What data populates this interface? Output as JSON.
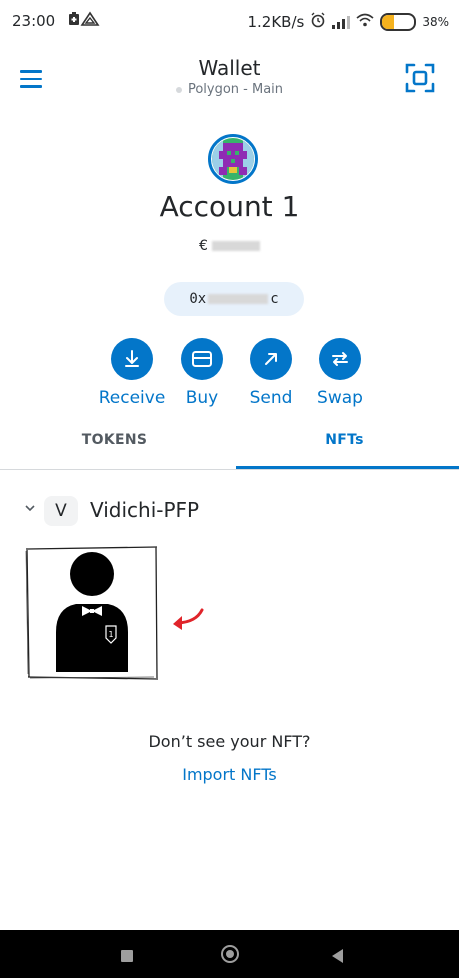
{
  "status_bar": {
    "time": "23:00",
    "net_speed": "1.2KB/s",
    "battery": "38%"
  },
  "header": {
    "title": "Wallet",
    "network": "Polygon - Main"
  },
  "account": {
    "name": "Account 1",
    "balance_prefix": "€",
    "address_prefix": "0x",
    "address_suffix": "c"
  },
  "actions": [
    {
      "label": "Receive",
      "icon": "receive-icon"
    },
    {
      "label": "Buy",
      "icon": "card-icon"
    },
    {
      "label": "Send",
      "icon": "send-arrow-icon"
    },
    {
      "label": "Swap",
      "icon": "swap-icon"
    }
  ],
  "tabs": [
    {
      "label": "TOKENS",
      "active": false
    },
    {
      "label": "NFTs",
      "active": true
    }
  ],
  "collection": {
    "badge": "V",
    "name": "Vidichi-PFP",
    "nft_badge_number": "1"
  },
  "empty_prompt": {
    "text": "Don’t see your NFT?",
    "link": "Import NFTs"
  },
  "colors": {
    "accent": "#0376c9",
    "annotation_arrow": "#e0242a"
  }
}
